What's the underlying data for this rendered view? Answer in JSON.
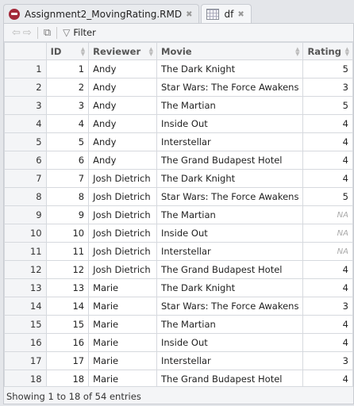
{
  "tabs": [
    {
      "label": "Assignment2_MovingRating.RMD",
      "icon": "rmd-file-icon"
    },
    {
      "label": "df",
      "icon": "data-grid-icon",
      "active": true
    }
  ],
  "toolbar": {
    "filter_label": "Filter"
  },
  "columns": [
    "",
    "ID",
    "Reviewer",
    "Movie",
    "Rating"
  ],
  "rows": [
    [
      1,
      1,
      "Andy",
      "The Dark Knight",
      "5"
    ],
    [
      2,
      2,
      "Andy",
      "Star Wars: The Force Awakens",
      "3"
    ],
    [
      3,
      3,
      "Andy",
      "The Martian",
      "5"
    ],
    [
      4,
      4,
      "Andy",
      "Inside Out",
      "4"
    ],
    [
      5,
      5,
      "Andy",
      "Interstellar",
      "4"
    ],
    [
      6,
      6,
      "Andy",
      "The Grand Budapest Hotel",
      "4"
    ],
    [
      7,
      7,
      "Josh Dietrich",
      "The Dark Knight",
      "4"
    ],
    [
      8,
      8,
      "Josh Dietrich",
      "Star Wars: The Force Awakens",
      "5"
    ],
    [
      9,
      9,
      "Josh Dietrich",
      "The Martian",
      "NA"
    ],
    [
      10,
      10,
      "Josh Dietrich",
      "Inside Out",
      "NA"
    ],
    [
      11,
      11,
      "Josh Dietrich",
      "Interstellar",
      "NA"
    ],
    [
      12,
      12,
      "Josh Dietrich",
      "The Grand Budapest Hotel",
      "4"
    ],
    [
      13,
      13,
      "Marie",
      "The Dark Knight",
      "4"
    ],
    [
      14,
      14,
      "Marie",
      "Star Wars: The Force Awakens",
      "3"
    ],
    [
      15,
      15,
      "Marie",
      "The Martian",
      "4"
    ],
    [
      16,
      16,
      "Marie",
      "Inside Out",
      "4"
    ],
    [
      17,
      17,
      "Marie",
      "Interstellar",
      "3"
    ],
    [
      18,
      18,
      "Marie",
      "The Grand Budapest Hotel",
      "4"
    ]
  ],
  "footer": "Showing 1 to 18 of 54 entries"
}
